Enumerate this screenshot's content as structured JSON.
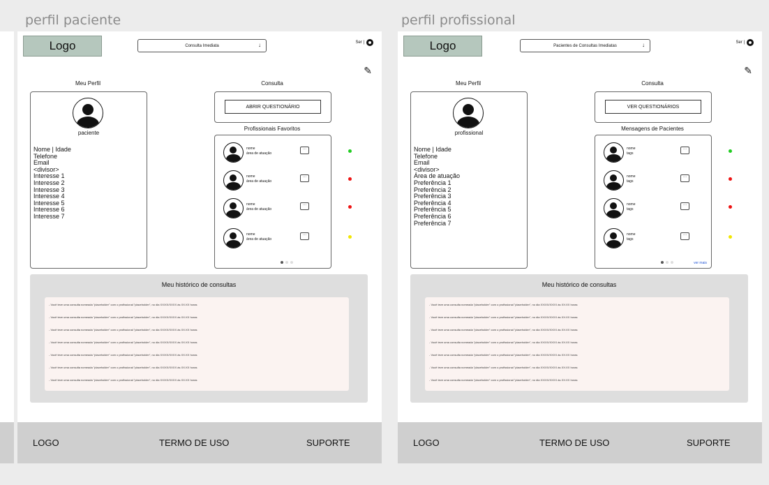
{
  "frames": [
    {
      "title": "perfil paciente",
      "logo": "Logo",
      "dropdown_label": "Consulta Imediata",
      "dropdown_arrow": "↓",
      "user_label": "Ser |",
      "edit_icon": "edit-icon",
      "profile_heading": "Meu Perfil",
      "profile_role": "paciente",
      "fields": [
        "Nome | Idade",
        "Telefone",
        "Email",
        "<divisor>",
        "Interesse 1",
        "Interesse 2",
        "Interesse 3",
        "Interesse 4",
        "Interesse 5",
        "Interesse 6",
        "Interesse 7"
      ],
      "consult_heading": "Consulta",
      "consult_button": "ABRIR QUESTIONÁRIO",
      "list_heading": "Profissionais Favoritos",
      "list_items": [
        {
          "name": "nome",
          "sub": "área de atuação",
          "status_color": "#22cc22"
        },
        {
          "name": "nome",
          "sub": "área de atuação",
          "status_color": "#ee1111"
        },
        {
          "name": "nome",
          "sub": "área de atuação",
          "status_color": "#ee1111"
        },
        {
          "name": "nome",
          "sub": "área de atuação",
          "status_color": "#f2e600"
        }
      ],
      "see_more": "",
      "history_title": "Meu histórico de consultas",
      "history_items": [
        "- Você teve uma consulta nomeada \"placeholder\" com o profissional \"placeholder\", no dia XX/XX/XXXX às XX:XX horas",
        "- Você teve uma consulta nomeada \"placeholder\" com o profissional \"placeholder\", no dia XX/XX/XXXX às XX:XX horas",
        "- Você teve uma consulta nomeada \"placeholder\" com o profissional \"placeholder\", no dia XX/XX/XXXX às XX:XX horas",
        "- Você teve uma consulta nomeada \"placeholder\" com o profissional \"placeholder\", no dia XX/XX/XXXX às XX:XX horas",
        "- Você teve uma consulta nomeada \"placeholder\" com o profissional \"placeholder\", no dia XX/XX/XXXX às XX:XX horas",
        "- Você teve uma consulta nomeada \"placeholder\" com o profissional \"placeholder\", no dia XX/XX/XXXX às XX:XX horas",
        "- Você teve uma consulta nomeada \"placeholder\" com o profissional \"placeholder\", no dia XX/XX/XXXX às XX:XX horas"
      ],
      "footer": {
        "logo": "LOGO",
        "terms": "TERMO DE USO",
        "support": "SUPORTE"
      }
    },
    {
      "title": "perfil profissional",
      "logo": "Logo",
      "dropdown_label": "Pacientes de Consultas Imediatas",
      "dropdown_arrow": "↓",
      "user_label": "Ser |",
      "edit_icon": "edit-icon",
      "profile_heading": "Meu Perfil",
      "profile_role": "profissional",
      "fields": [
        "Nome | Idade",
        "Telefone",
        "Email",
        "<divisor>",
        "Área de atuação",
        "Preferência 1",
        "Preferência 2",
        "Preferência 3",
        "Preferência 4",
        "Preferência 5",
        "Preferência 6",
        "Preferência 7"
      ],
      "consult_heading": "Consulta",
      "consult_button": "VER QUESTIONÁRIOS",
      "list_heading": "Mensagens de Pacientes",
      "list_items": [
        {
          "name": "nome",
          "sub": "tags",
          "status_color": "#22cc22"
        },
        {
          "name": "nome",
          "sub": "tags",
          "status_color": "#ee1111"
        },
        {
          "name": "nome",
          "sub": "tags",
          "status_color": "#ee1111"
        },
        {
          "name": "nome",
          "sub": "tags",
          "status_color": "#f2e600"
        }
      ],
      "see_more": "ver mais",
      "history_title": "Meu histórico de consultas",
      "history_items": [
        "- Você teve uma consulta nomeada \"placeholder\" com o profissional \"placeholder\", no dia XX/XX/XXXX às XX:XX horas",
        "- Você teve uma consulta nomeada \"placeholder\" com o profissional \"placeholder\", no dia XX/XX/XXXX às XX:XX horas",
        "- Você teve uma consulta nomeada \"placeholder\" com o profissional \"placeholder\", no dia XX/XX/XXXX às XX:XX horas",
        "- Você teve uma consulta nomeada \"placeholder\" com o profissional \"placeholder\", no dia XX/XX/XXXX às XX:XX horas",
        "- Você teve uma consulta nomeada \"placeholder\" com o profissional \"placeholder\", no dia XX/XX/XXXX às XX:XX horas",
        "- Você teve uma consulta nomeada \"placeholder\" com o profissional \"placeholder\", no dia XX/XX/XXXX às XX:XX horas",
        "- Você teve uma consulta nomeada \"placeholder\" com o profissional \"placeholder\", no dia XX/XX/XXXX às XX:XX horas"
      ],
      "footer": {
        "logo": "LOGO",
        "terms": "TERMO DE USO",
        "support": "SUPORTE"
      }
    }
  ]
}
